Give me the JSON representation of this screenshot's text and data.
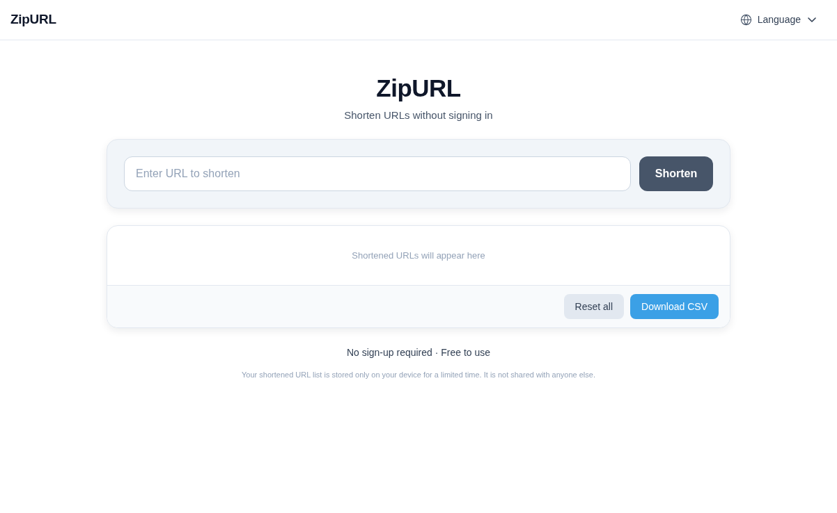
{
  "header": {
    "logo": "ZipURL",
    "language_menu": {
      "label": "Language"
    }
  },
  "hero": {
    "title": "ZipURL",
    "subtitle": "Shorten URLs without signing in"
  },
  "shorten_form": {
    "url_input": {
      "placeholder": "Enter URL to shorten"
    },
    "submit_button": "Shorten"
  },
  "results_panel": {
    "empty_message": "Shortened URLs will appear here",
    "buttons": [
      {
        "label": "Reset all",
        "kind": "secondary"
      },
      {
        "label": "Download CSV",
        "kind": "primary"
      }
    ]
  },
  "footer": {
    "tagline": "No sign-up required · Free to use",
    "privacy_note": "Your shortened URL list is stored only on your device for a limited time. It is not shared with anyone else."
  }
}
